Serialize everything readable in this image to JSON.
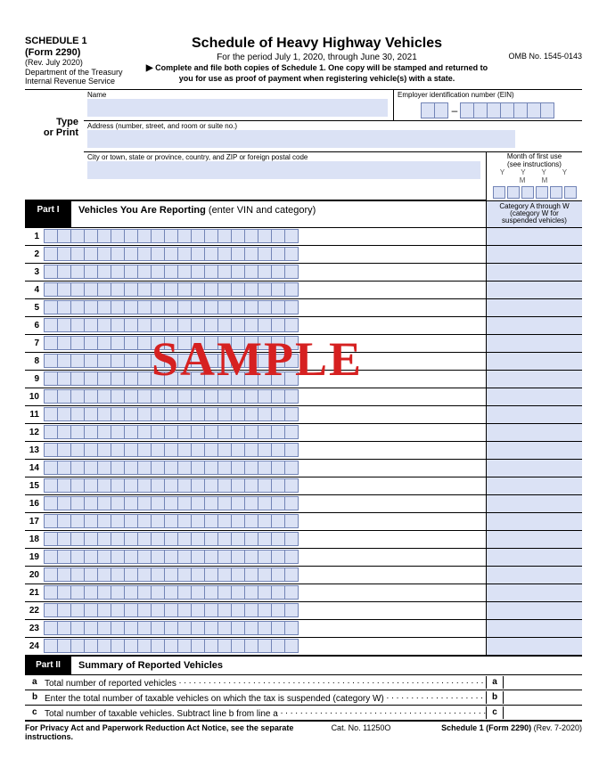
{
  "header": {
    "schedule": "SCHEDULE 1",
    "form": "(Form 2290)",
    "rev": "(Rev. July 2020)",
    "dept": "Department of the Treasury",
    "irs": "Internal Revenue Service",
    "title": "Schedule of Heavy Highway Vehicles",
    "period": "For the period July 1, 2020, through June 30, 2021",
    "instr1": "Complete and file both copies of Schedule 1. One copy will be stamped and returned to",
    "instr2": "you for use as proof of payment when registering vehicle(s) with a state.",
    "omb": "OMB No. 1545-0143"
  },
  "labels": {
    "type": "Type",
    "orprint": "or Print",
    "name": "Name",
    "ein": "Employer identification number (EIN)",
    "address": "Address (number, street, and room or suite no.)",
    "city": "City or town, state or province, country, and ZIP or foreign postal code",
    "month1": "Month of first use",
    "month2": "(see instructions)",
    "monthYYYYMM": "Y  Y  Y  Y  M  M"
  },
  "part1": {
    "label": "Part I",
    "title_bold": "Vehicles You Are Reporting",
    "title_rest": " (enter VIN and category)",
    "cat_head1": "Category A through W",
    "cat_head2": "(category W for",
    "cat_head3": "suspended vehicles)"
  },
  "vin_rows": 24,
  "vin_cols": 19,
  "part2": {
    "label": "Part II",
    "title": "Summary of Reported Vehicles",
    "a": "Total number of reported vehicles",
    "b": "Enter the total number of taxable vehicles on which the tax is suspended (category W)",
    "c": "Total number of taxable vehicles. Subtract line b from line a",
    "la": "a",
    "lb": "b",
    "lc": "c"
  },
  "footer": {
    "left": "For Privacy Act and Paperwork Reduction Act Notice, see the separate instructions.",
    "center": "Cat. No. 11250O",
    "right_b": "Schedule 1 (Form 2290)",
    "right_r": " (Rev. 7-2020)"
  },
  "watermark": "SAMPLE"
}
